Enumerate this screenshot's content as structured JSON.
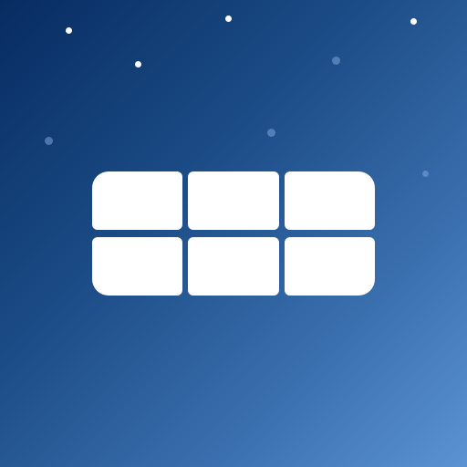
{
  "icon": {
    "name": "grid-layout-icon",
    "cells": 6,
    "rows": 2,
    "columns": 3
  },
  "colors": {
    "gradient_top_left": "#072c62",
    "gradient_bottom_right": "#5b93d3",
    "glyph": "#ffffff",
    "star": "#ffffff"
  }
}
